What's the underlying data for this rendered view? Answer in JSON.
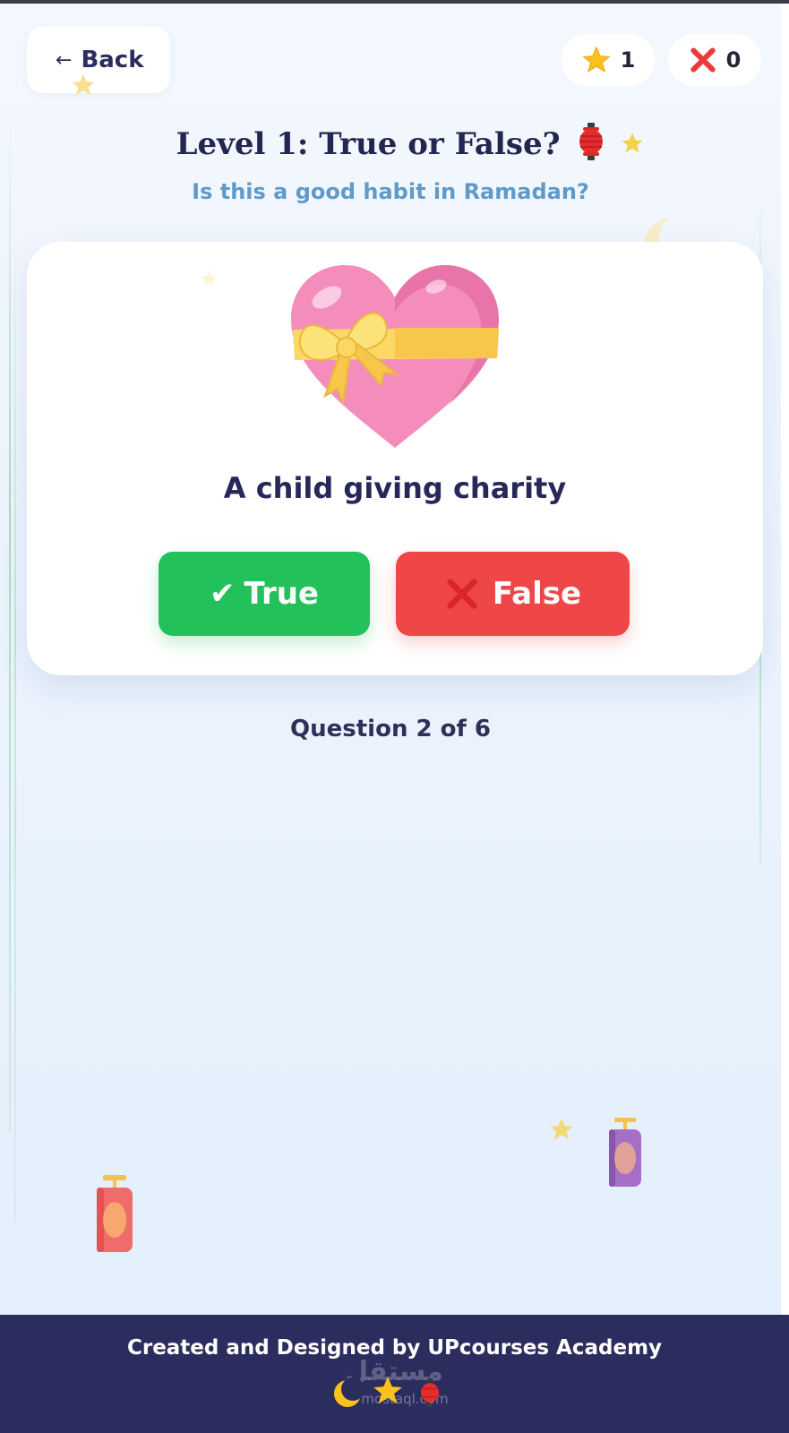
{
  "header": {
    "back_label": "Back",
    "back_arrow": "←",
    "stars_count": "1",
    "wrong_count": "0"
  },
  "level": {
    "title": "Level 1: True or False?",
    "subtitle": "Is this a good habit in Ramadan?"
  },
  "question": {
    "image_icon": "heart-with-ribbon",
    "statement": "A child giving charity",
    "true_label": "True",
    "true_icon": "✔",
    "false_label": "False",
    "progress": "Question 2 of 6"
  },
  "footer": {
    "credit": "Created and Designed by UPcourses Academy",
    "watermark": "مستقل",
    "watermark_sub": "mostaql.com"
  },
  "colors": {
    "true_button": "#22c15a",
    "false_button": "#ef4648",
    "footer_bg": "#2b2d5e",
    "title": "#23264f",
    "subtitle": "#5f9ac9"
  }
}
